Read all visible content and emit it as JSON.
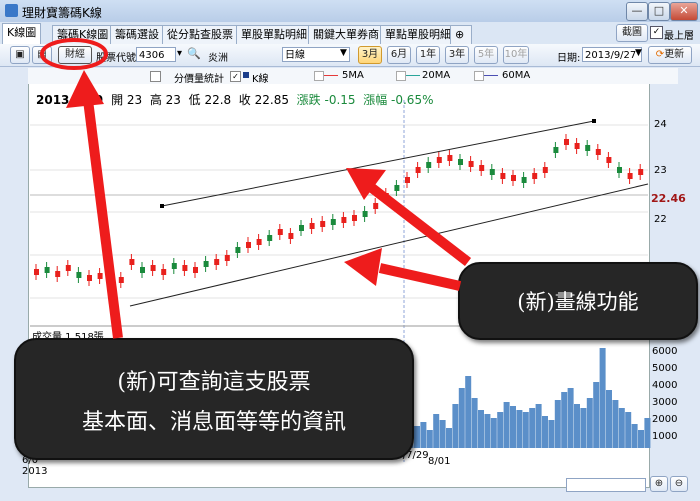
{
  "window": {
    "title": "理財寶籌碼K線",
    "minimize": "—",
    "maximize": "□",
    "close": "✕"
  },
  "tabs": [
    "K線圖",
    "籌碼K線圖",
    "籌碼選設",
    "從分點查股票",
    "單股單點明細",
    "關鍵大單券商",
    "單點單股明細"
  ],
  "tabs_extra": [
    "截圖",
    "最上層"
  ],
  "toolbar": {
    "finance_label": "財經",
    "stock_code_label": "股票代號:",
    "stock_code": "4306",
    "stock_name": "炎洲",
    "period": "日線",
    "ranges": [
      "3月",
      "6月",
      "1年",
      "3年",
      "5年",
      "10年"
    ],
    "date_label": "日期:",
    "date": "2013/9/27",
    "refresh": "更新"
  },
  "legend": {
    "items": [
      "分價量統計",
      "K線",
      "5MA",
      "20MA",
      "60MA"
    ]
  },
  "info": {
    "date": "2013",
    "open_label": "開",
    "open": "23",
    "high_label": "高",
    "high": "23",
    "low_label": "低",
    "low": "22.8",
    "close_label": "收",
    "close": "22.85",
    "change_label": "漲跌",
    "change": "-0.15",
    "pct_label": "漲幅",
    "pct": "-0.65%"
  },
  "price_axis": [
    "24",
    "23",
    "22.46",
    "22"
  ],
  "volume_axis": [
    "6000",
    "5000",
    "4000",
    "3000",
    "2000",
    "1000"
  ],
  "volume_label": "成交量 1,518張",
  "date_labels": [
    "6/0",
    "2013",
    "13/7/29",
    "8/01"
  ],
  "callouts": {
    "draw": "(新)畫線功能",
    "fund_line1": "(新)可查詢這支股票",
    "fund_line2": "基本面、消息面等等的資訊"
  },
  "colors": {
    "up": "#e8201c",
    "down": "#1a8a3c",
    "volume": "#5b8fc9",
    "arrow": "#ee1c1c",
    "price_current": "#a11717"
  }
}
